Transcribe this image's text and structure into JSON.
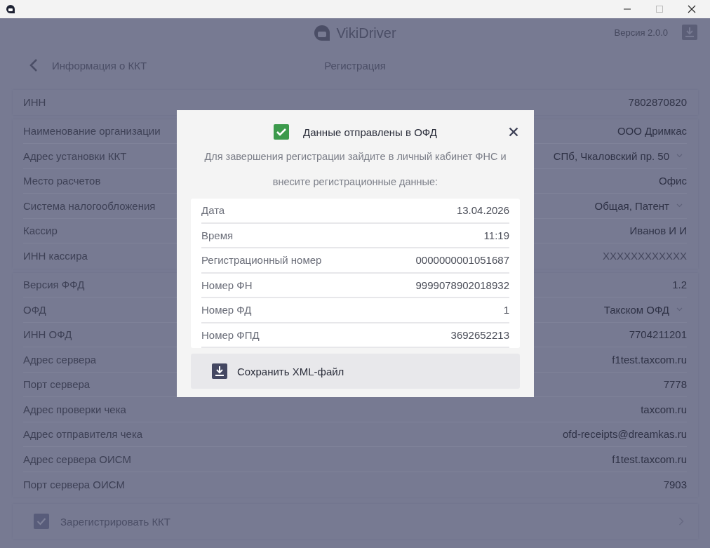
{
  "app_header": {
    "title": "VikiDriver",
    "version": "Версия 2.0.0"
  },
  "nav": {
    "back_label": "Информация о ККТ",
    "title": "Регистрация"
  },
  "groups": [
    [
      {
        "label": "ИНН",
        "value": "7802870820",
        "kind": "text"
      }
    ],
    [
      {
        "label": "Наименование организации",
        "value": "ООО Дримкас",
        "kind": "text"
      },
      {
        "label": "Адрес установки ККТ",
        "value": "СПб, Чкаловский пр. 50",
        "kind": "select"
      },
      {
        "label": "Место расчетов",
        "value": "Офис",
        "kind": "text"
      },
      {
        "label": "Система налогообложения",
        "value": "Общая, Патент",
        "kind": "select"
      },
      {
        "label": "Кассир",
        "value": "Иванов И И",
        "kind": "text"
      },
      {
        "label": "ИНН кассира",
        "placeholder": "XXXXXXXXXXXX",
        "kind": "input"
      }
    ],
    [
      {
        "label": "Версия ФФД",
        "value": "1.2",
        "kind": "text"
      },
      {
        "label": "ОФД",
        "value": "Такском ОФД",
        "kind": "select"
      },
      {
        "label": "ИНН ОФД",
        "value": "7704211201",
        "kind": "text"
      },
      {
        "label": "Адрес сервера",
        "value": "f1test.taxcom.ru",
        "kind": "text"
      },
      {
        "label": "Порт сервера",
        "value": "7778",
        "kind": "text"
      },
      {
        "label": "Адрес проверки чека",
        "value": "taxcom.ru",
        "kind": "text"
      },
      {
        "label": "Адрес отправителя чека",
        "value": "ofd-receipts@dreamkas.ru",
        "kind": "text"
      },
      {
        "label": "Адрес сервера ОИСМ",
        "value": "f1test.taxcom.ru",
        "kind": "text"
      },
      {
        "label": "Порт сервера ОИСМ",
        "value": "7903",
        "kind": "text"
      }
    ]
  ],
  "register": {
    "label": "Зарегистрировать ККТ",
    "checked": true
  },
  "dialog": {
    "title": "Данные отправлены в ОФД",
    "description": "Для завершения регистрации зайдите в личный кабинет ФНС и внесите регистрационные данные:",
    "rows": [
      {
        "label": "Дата",
        "value": "13.04.2026"
      },
      {
        "label": "Время",
        "value": "11:19"
      },
      {
        "label": "Регистрационный номер",
        "value": "0000000001051687"
      },
      {
        "label": "Номер ФН",
        "value": "9999078902018932"
      },
      {
        "label": "Номер ФД",
        "value": "1"
      },
      {
        "label": "Номер ФПД",
        "value": "3692652213"
      }
    ],
    "save_button": "Сохранить XML-файл"
  }
}
